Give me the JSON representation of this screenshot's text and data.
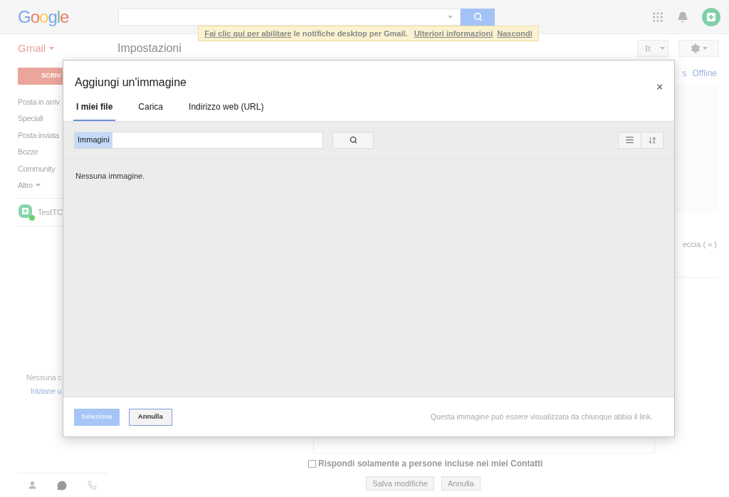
{
  "header": {
    "logo": "Google"
  },
  "notification": {
    "link": "Fai clic qui per abilitare",
    "text": "le notifiche desktop per Gmail.",
    "more_link": "Ulteriori informazioni",
    "hide_link": "Nascondi"
  },
  "app_bar": {
    "app_name": "Gmail",
    "page_title": "Impostazioni",
    "language_button": "It"
  },
  "sidebar": {
    "compose": "SCRIV",
    "items": [
      "Posta in arriv",
      "Speciali",
      "Posta inviata",
      "Bozze",
      "Community",
      "Altro"
    ],
    "chat_contact": "TestTC",
    "empty_text": "Nessuna c",
    "start_link": "Iniziane u"
  },
  "settings": {
    "tabs": [
      "s",
      "Offline"
    ],
    "fragment": "eccia ( » )",
    "reply_option": {
      "label": "Rispondi solamente a persone incluse nei miei Contatti",
      "checked": false
    },
    "buttons": [
      "Salva modifiche",
      "Annulla"
    ]
  },
  "dialog": {
    "title": "Aggiungi un'immagine",
    "close": "×",
    "tabs": [
      {
        "label": "I miei file",
        "selected": true
      },
      {
        "label": "Carica",
        "selected": false
      },
      {
        "label": "Indirizzo web (URL)",
        "selected": false
      }
    ],
    "search": {
      "value": "Immagini"
    },
    "empty_message": "Nessuna immagine.",
    "buttons": [
      {
        "label": "Selezione",
        "disabled": true
      },
      {
        "label": "Annulla",
        "disabled": false
      }
    ],
    "note": "Questa immagine può essere visualizzata da chiunque abbia il link."
  }
}
